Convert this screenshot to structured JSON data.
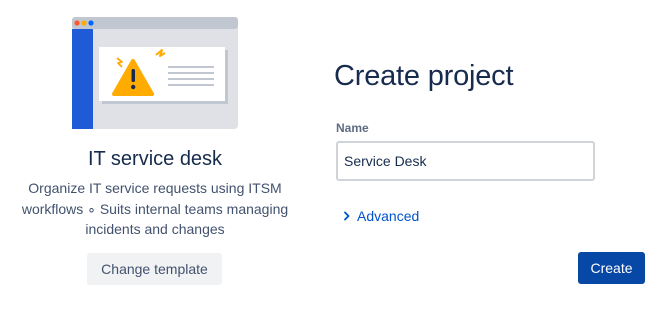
{
  "template": {
    "title": "IT service desk",
    "description": "Organize IT service requests using ITSM workflows ∘ Suits internal teams managing incidents and changes",
    "change_button_label": "Change template",
    "illustration_icon": "warning-window-illustration"
  },
  "form": {
    "heading": "Create project",
    "name_label": "Name",
    "name_value": "Service Desk",
    "advanced_label": "Advanced",
    "create_button_label": "Create"
  },
  "colors": {
    "primary_button": "#0747a6",
    "link": "#0052cc",
    "illustration_sidebar": "#1f5bd6",
    "warning": "#ffab00"
  }
}
